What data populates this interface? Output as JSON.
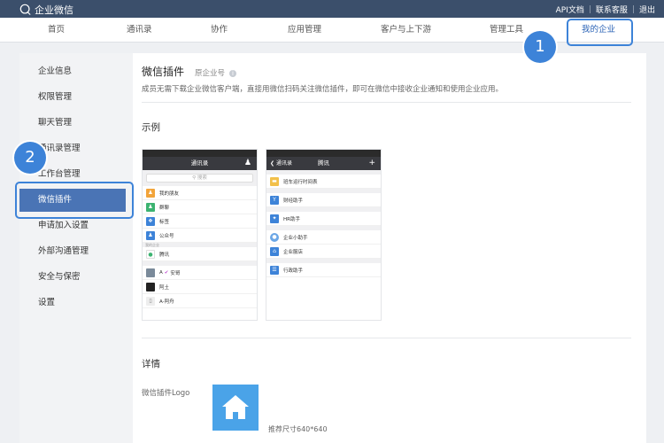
{
  "app": {
    "brand_name": "企业微信"
  },
  "top_links": [
    "API文档",
    "联系客服",
    "退出"
  ],
  "nav": {
    "items": [
      "首页",
      "通讯录",
      "协作",
      "应用管理",
      "客户与上下游",
      "管理工具",
      "我的企业"
    ],
    "active": "我的企业"
  },
  "badges": [
    "1",
    "2"
  ],
  "sidebar": {
    "items": [
      "企业信息",
      "权限管理",
      "聊天管理",
      "通讯录管理",
      "工作台管理",
      "微信插件",
      "申请加入设置",
      "外部沟通管理",
      "安全与保密",
      "设置"
    ],
    "active": "微信插件"
  },
  "content": {
    "title": "微信插件",
    "title_sub": "原企业号",
    "info_icon": "i",
    "description": "成员无需下载企业微信客户端，直接用微信扫码关注微信插件，即可在微信中接收企业通知和使用企业应用。",
    "example_title": "示例",
    "details_title": "详情",
    "logo_label": "微信插件Logo",
    "logo_hint": "推荐尺寸640*640"
  },
  "phone1": {
    "title": "通讯录",
    "search": "搜索",
    "items": [
      {
        "label": "我的朋友",
        "color": "#f2a43a"
      },
      {
        "label": "群聊",
        "color": "#3cb371"
      },
      {
        "label": "标签",
        "color": "#3d83d8"
      },
      {
        "label": "公众号",
        "color": "#3d83d8"
      }
    ],
    "group_label": "我的企业",
    "org_item": "腾讯",
    "contacts": [
      "A",
      "阿土",
      "A-阿舟"
    ],
    "contact_a_tag": "安哥"
  },
  "phone2": {
    "back": "通讯录",
    "title": "腾讯",
    "items": [
      {
        "label": "班车运行时间表",
        "color": "#f2c04a"
      },
      {
        "label": "财经助手",
        "color": "#3d83d8"
      },
      {
        "label": "HR助手",
        "color": "#3d83d8"
      },
      {
        "label": "企业小助手",
        "color": "#6aa6e6"
      },
      {
        "label": "企业服店",
        "color": "#3d83d8"
      },
      {
        "label": "行政助手",
        "color": "#3d83d8"
      }
    ]
  },
  "colors": {
    "topbar": "#3b4f6b",
    "accent": "#3d83d8",
    "sidebar_active": "#4a74b5",
    "logo_bg": "#4aa3e8"
  }
}
